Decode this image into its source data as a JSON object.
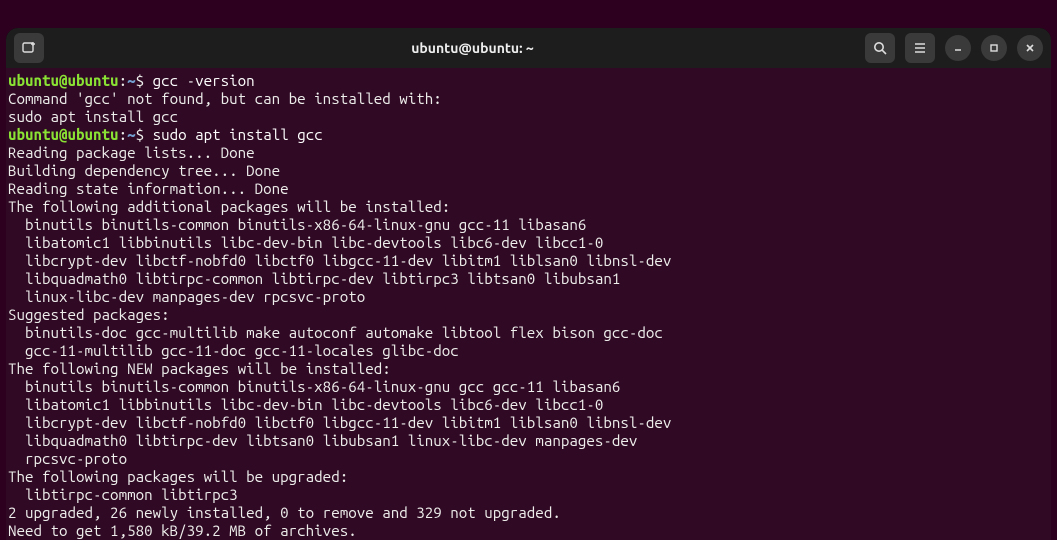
{
  "titlebar": {
    "title": "ubuntu@ubuntu: ~"
  },
  "term": {
    "prompt_user": "ubuntu@ubuntu",
    "colon": ":",
    "prompt_path": "~",
    "prompt_sym": "$ ",
    "cmd1": "gcc -version",
    "out1": "Command 'gcc' not found, but can be installed with:",
    "out2": "sudo apt install gcc",
    "cmd2": "sudo apt install gcc",
    "l1": "Reading package lists... Done",
    "l2": "Building dependency tree... Done",
    "l3": "Reading state information... Done",
    "l4": "The following additional packages will be installed:",
    "l5": "  binutils binutils-common binutils-x86-64-linux-gnu gcc-11 libasan6",
    "l6": "  libatomic1 libbinutils libc-dev-bin libc-devtools libc6-dev libcc1-0",
    "l7": "  libcrypt-dev libctf-nobfd0 libctf0 libgcc-11-dev libitm1 liblsan0 libnsl-dev",
    "l8": "  libquadmath0 libtirpc-common libtirpc-dev libtirpc3 libtsan0 libubsan1",
    "l9": "  linux-libc-dev manpages-dev rpcsvc-proto",
    "l10": "Suggested packages:",
    "l11": "  binutils-doc gcc-multilib make autoconf automake libtool flex bison gcc-doc",
    "l12": "  gcc-11-multilib gcc-11-doc gcc-11-locales glibc-doc",
    "l13": "The following NEW packages will be installed:",
    "l14": "  binutils binutils-common binutils-x86-64-linux-gnu gcc gcc-11 libasan6",
    "l15": "  libatomic1 libbinutils libc-dev-bin libc-devtools libc6-dev libcc1-0",
    "l16": "  libcrypt-dev libctf-nobfd0 libctf0 libgcc-11-dev libitm1 liblsan0 libnsl-dev",
    "l17": "  libquadmath0 libtirpc-dev libtsan0 libubsan1 linux-libc-dev manpages-dev",
    "l18": "  rpcsvc-proto",
    "l19": "The following packages will be upgraded:",
    "l20": "  libtirpc-common libtirpc3",
    "l21": "2 upgraded, 26 newly installed, 0 to remove and 329 not upgraded.",
    "l22": "Need to get 1,580 kB/39.2 MB of archives."
  }
}
